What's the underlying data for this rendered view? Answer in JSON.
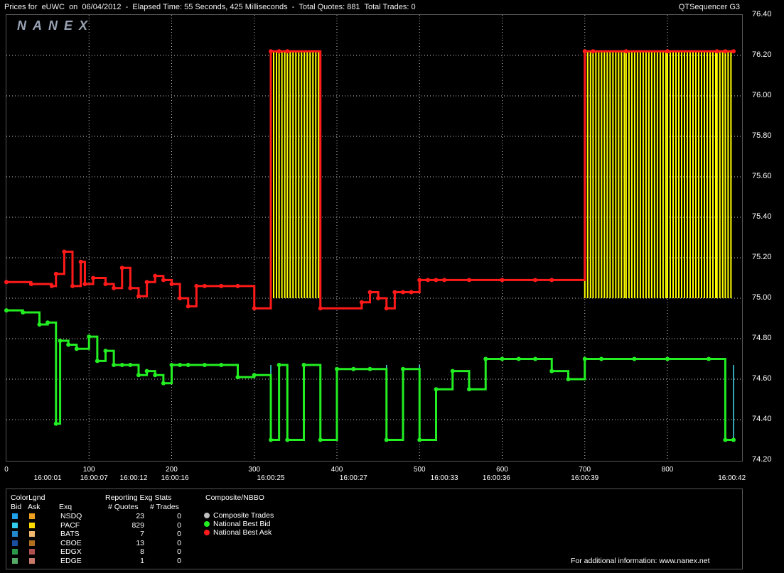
{
  "header": {
    "title": "Prices for  eUWC  on  06/04/2012  -  Elapsed Time: 55 Seconds, 425 Milliseconds  -  Total Quotes: 881  Total Trades: 0",
    "app_name": "QTSequencer G3",
    "logo": "NANEX"
  },
  "colors": {
    "bid": "#22ee22",
    "ask": "#ff1a1a",
    "ask_fill": "#ffff00",
    "bid_fill": "#44ddee",
    "grid": "#c8c8c8"
  },
  "chart_data": {
    "type": "line",
    "ylim": [
      74.2,
      76.4
    ],
    "xlim": [
      0,
      880
    ],
    "y_ticks": [
      "76.40",
      "76.20",
      "76.00",
      "75.80",
      "75.60",
      "75.40",
      "75.20",
      "75.00",
      "74.80",
      "74.60",
      "74.40",
      "74.20"
    ],
    "x_ticks": [
      {
        "value": 0,
        "label": "0"
      },
      {
        "value": 100,
        "label": "100"
      },
      {
        "value": 200,
        "label": "200"
      },
      {
        "value": 300,
        "label": "300"
      },
      {
        "value": 400,
        "label": "400"
      },
      {
        "value": 500,
        "label": "500"
      },
      {
        "value": 600,
        "label": "600"
      },
      {
        "value": 700,
        "label": "700"
      },
      {
        "value": 800,
        "label": "800"
      }
    ],
    "time_labels": [
      {
        "value": 50,
        "label": "16:00:01"
      },
      {
        "value": 106,
        "label": "16:00:07"
      },
      {
        "value": 154,
        "label": "16:00:12"
      },
      {
        "value": 204,
        "label": "16:00:16"
      },
      {
        "value": 320,
        "label": "16:00:25"
      },
      {
        "value": 420,
        "label": "16:00:27"
      },
      {
        "value": 530,
        "label": "16:00:33"
      },
      {
        "value": 593,
        "label": "16:00:36"
      },
      {
        "value": 700,
        "label": "16:00:39"
      },
      {
        "value": 878,
        "label": "16:00:42"
      }
    ],
    "series": [
      {
        "name": "National Best Ask",
        "x": [
          0,
          30,
          55,
          60,
          70,
          80,
          90,
          95,
          105,
          120,
          130,
          140,
          150,
          160,
          170,
          180,
          190,
          200,
          210,
          220,
          230,
          240,
          260,
          280,
          300,
          320,
          330,
          340,
          380,
          430,
          440,
          450,
          460,
          470,
          480,
          490,
          500,
          510,
          520,
          530,
          560,
          600,
          640,
          660,
          700,
          710,
          750,
          800,
          860,
          870,
          880
        ],
        "y": [
          75.08,
          75.07,
          75.06,
          75.12,
          75.23,
          75.06,
          75.18,
          75.07,
          75.1,
          75.07,
          75.05,
          75.15,
          75.05,
          75.01,
          75.08,
          75.11,
          75.09,
          75.07,
          75.0,
          74.96,
          75.06,
          75.06,
          75.06,
          75.06,
          74.95,
          76.22,
          76.22,
          76.22,
          74.95,
          74.98,
          75.03,
          75.0,
          74.95,
          75.03,
          75.03,
          75.03,
          75.09,
          75.09,
          75.09,
          75.09,
          75.09,
          75.09,
          75.09,
          75.09,
          76.22,
          76.22,
          76.22,
          76.22,
          76.22,
          76.22,
          76.22
        ]
      },
      {
        "name": "National Best Bid",
        "x": [
          0,
          20,
          40,
          50,
          60,
          65,
          75,
          85,
          100,
          110,
          120,
          130,
          140,
          150,
          160,
          170,
          180,
          190,
          200,
          210,
          220,
          240,
          260,
          280,
          300,
          320,
          330,
          340,
          360,
          380,
          400,
          420,
          440,
          460,
          480,
          500,
          520,
          540,
          560,
          580,
          600,
          620,
          640,
          660,
          680,
          700,
          720,
          760,
          800,
          850,
          870,
          880
        ],
        "y": [
          74.94,
          74.93,
          74.87,
          74.88,
          74.38,
          74.79,
          74.77,
          74.75,
          74.81,
          74.69,
          74.74,
          74.67,
          74.67,
          74.67,
          74.62,
          74.64,
          74.62,
          74.58,
          74.67,
          74.67,
          74.67,
          74.67,
          74.67,
          74.61,
          74.62,
          74.3,
          74.67,
          74.3,
          74.67,
          74.3,
          74.65,
          74.65,
          74.65,
          74.3,
          74.65,
          74.3,
          74.55,
          74.64,
          74.55,
          74.7,
          74.7,
          74.7,
          74.7,
          74.64,
          74.6,
          74.7,
          74.7,
          74.7,
          74.7,
          74.7,
          74.3,
          74.3
        ]
      }
    ]
  },
  "legend": {
    "color_legend_title": "ColorLgnd",
    "bid_header": "Bid",
    "ask_header": "Ask",
    "stats_title": "Reporting Exg Stats",
    "exq_header": "Exq",
    "quotes_header": "# Quotes",
    "trades_header": "# Trades",
    "composite_title": "Composite/NBBO",
    "exchanges": [
      {
        "name": "NSDQ",
        "quotes": "23",
        "trades": "0",
        "bid_color": "#1e9fe8",
        "ask_color": "#f0a020"
      },
      {
        "name": "PACF",
        "quotes": "829",
        "trades": "0",
        "bid_color": "#33ccee",
        "ask_color": "#ffdd00"
      },
      {
        "name": "BATS",
        "quotes": "7",
        "trades": "0",
        "bid_color": "#2288cc",
        "ask_color": "#f2b870"
      },
      {
        "name": "CBOE",
        "quotes": "13",
        "trades": "0",
        "bid_color": "#1a4fa0",
        "ask_color": "#b07020"
      },
      {
        "name": "EDGX",
        "quotes": "8",
        "trades": "0",
        "bid_color": "#2a9a4a",
        "ask_color": "#b05050"
      },
      {
        "name": "EDGE",
        "quotes": "1",
        "trades": "0",
        "bid_color": "#55aa66",
        "ask_color": "#c87a6a"
      }
    ],
    "composite": [
      {
        "label": "Composite Trades",
        "color": "#c0c0c0"
      },
      {
        "label": "National Best Bid",
        "color": "#22ee22"
      },
      {
        "label": "National Best Ask",
        "color": "#ff1a1a"
      }
    ],
    "footer": "For additional information: www.nanex.net"
  }
}
